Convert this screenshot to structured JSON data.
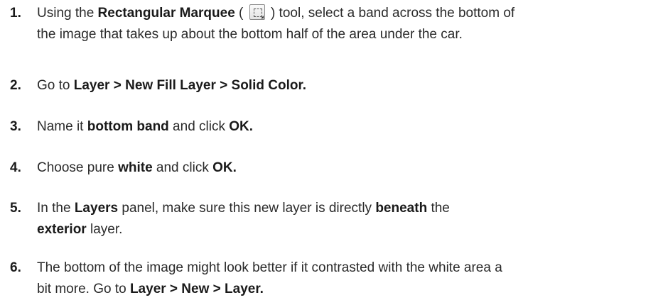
{
  "steps": [
    {
      "number": "1.",
      "t1": "Using the ",
      "b1": "Rectangular Marquee",
      "t2": " ( ",
      "icon": "rectangular-marquee-tool-icon",
      "t3": " ) tool, select a band across the bottom of",
      "t4": "the image that takes up about the bottom half of the area under the car."
    },
    {
      "number": "2.",
      "t1": "Go to ",
      "b1": "Layer > New Fill Layer > Solid Color."
    },
    {
      "number": "3.",
      "t1": "Name it ",
      "b1": "bottom band",
      "t2": " and click ",
      "b2": "OK."
    },
    {
      "number": "4.",
      "t1": "Choose pure ",
      "b1": "white",
      "t2": " and click ",
      "b2": "OK."
    },
    {
      "number": "5.",
      "t1": "In the ",
      "b1": "Layers",
      "t2": " panel, make sure this new layer is directly ",
      "b2": "beneath",
      "t3": " the",
      "b3": "exterior",
      "t4": " layer."
    },
    {
      "number": "6.",
      "t1": "The bottom of the image might look better if it contrasted with the white area a",
      "t2": "bit more. Go to ",
      "b1": "Layer > New > Layer."
    }
  ]
}
